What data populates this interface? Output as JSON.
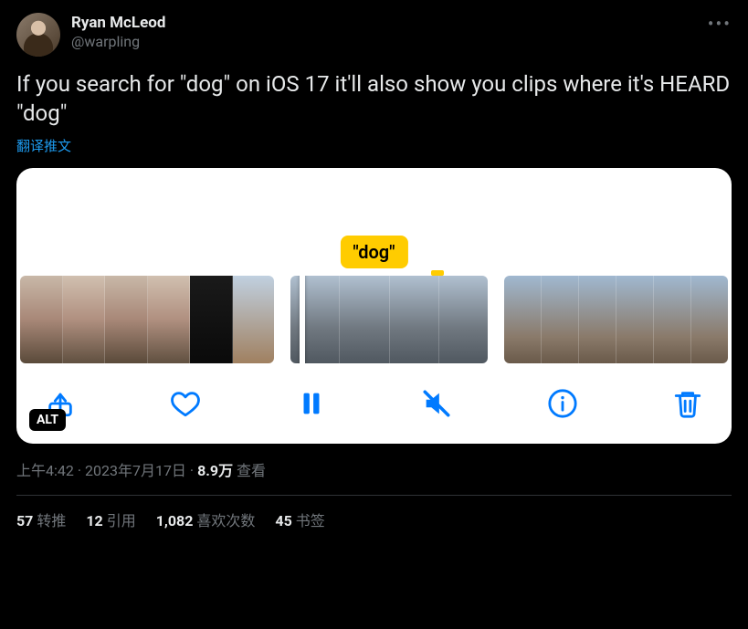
{
  "author": {
    "display_name": "Ryan McLeod",
    "handle": "@warpling"
  },
  "body": "If you search for \"dog\" on iOS 17 it'll also show you clips where it's HEARD \"dog\"",
  "translate_label": "翻译推文",
  "media": {
    "tooltip_label": "\"dog\"",
    "alt_badge": "ALT"
  },
  "meta": {
    "time": "上午4:42",
    "separator": " · ",
    "date": "2023年7月17日",
    "views_count": "8.9万",
    "views_label": " 查看"
  },
  "stats": {
    "retweets": {
      "count": "57",
      "label": "转推"
    },
    "quotes": {
      "count": "12",
      "label": "引用"
    },
    "likes": {
      "count": "1,082",
      "label": "喜欢次数"
    },
    "bookmarks": {
      "count": "45",
      "label": "书签"
    }
  }
}
